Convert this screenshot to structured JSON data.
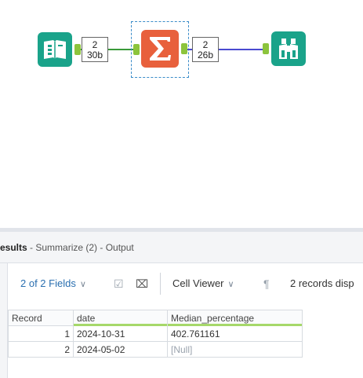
{
  "workflow": {
    "connection1": {
      "records": "2",
      "size": "30b"
    },
    "connection2": {
      "records": "2",
      "size": "26b"
    },
    "icons": {
      "input": "book-input-icon",
      "summarize": "sigma-summarize-icon",
      "browse": "binoculars-browse-icon"
    },
    "colors": {
      "input_tool": "#1aa38a",
      "summarize_tool": "#e8603c",
      "browse_tool": "#1aa38a",
      "connection_green": "#3a9a3a",
      "connection_blue": "#4a4ad0",
      "anchor": "#8cc43c",
      "selection": "#3a8cc9"
    }
  },
  "results": {
    "title_bold": "esults",
    "title_rest": " - Summarize (2) - Output",
    "toolbar": {
      "fields_label": "2 of 2 Fields",
      "cell_viewer_label": "Cell Viewer",
      "records_message": "2 records disp"
    },
    "table": {
      "headers": [
        "Record",
        "date",
        "Median_percentage"
      ],
      "rows": [
        {
          "record": "1",
          "date": "2024-10-31",
          "median": "402.761161"
        },
        {
          "record": "2",
          "date": "2024-05-02",
          "median": "[Null]"
        }
      ]
    }
  }
}
